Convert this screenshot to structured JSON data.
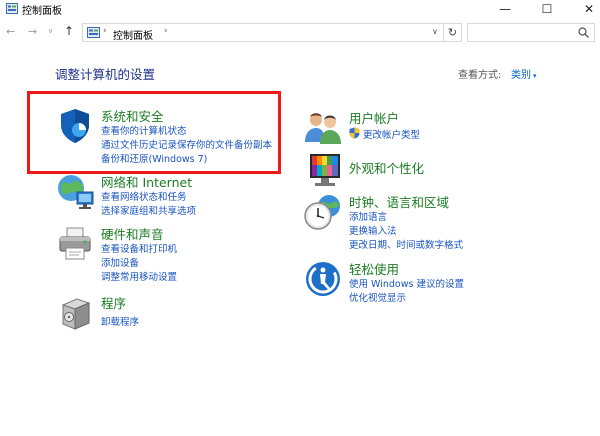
{
  "window": {
    "title": "控制面板",
    "minimize": "—",
    "maximize": "☐",
    "close": "✕"
  },
  "nav": {
    "back": "←",
    "forward": "→",
    "history": "∨",
    "up": "↑",
    "separator": "›",
    "breadcrumb": "控制面板",
    "dropdown": "∨",
    "refresh": "↻",
    "search_placeholder": ""
  },
  "page": {
    "title": "调整计算机的设置",
    "view_by_label": "查看方式:",
    "view_by_value": "类别",
    "view_by_arrow": "▾"
  },
  "categories": {
    "system_security": {
      "heading": "系统和安全",
      "links": [
        "查看你的计算机状态",
        "通过文件历史记录保存你的文件备份副本",
        "备份和还原(Windows 7)"
      ]
    },
    "network": {
      "heading": "网络和 Internet",
      "links": [
        "查看网络状态和任务",
        "选择家庭组和共享选项"
      ]
    },
    "hardware": {
      "heading": "硬件和声音",
      "links": [
        "查看设备和打印机",
        "添加设备",
        "调整常用移动设置"
      ]
    },
    "programs": {
      "heading": "程序",
      "links": [
        "卸载程序"
      ]
    },
    "user_accounts": {
      "heading": "用户帐户",
      "links": [
        "更改帐户类型"
      ]
    },
    "appearance": {
      "heading": "外观和个性化",
      "links": []
    },
    "clock_region": {
      "heading": "时钟、语言和区域",
      "links": [
        "添加语言",
        "更换输入法",
        "更改日期、时间或数字格式"
      ]
    },
    "ease_of_access": {
      "heading": "轻松使用",
      "links": [
        "使用 Windows 建议的设置",
        "优化视觉显示"
      ]
    }
  },
  "colors": {
    "heading_green": "#1b7c22",
    "link_blue": "#1a55c0",
    "title_blue": "#1e3287",
    "highlight_red": "#ee1a1a"
  },
  "icons": {
    "system_security": "shield-icon",
    "network": "globe-network-icon",
    "hardware": "printer-icon",
    "programs": "programs-box-icon",
    "user_accounts": "users-icon",
    "appearance": "monitor-palette-icon",
    "clock_region": "clock-globe-icon",
    "ease_of_access": "accessibility-icon"
  }
}
